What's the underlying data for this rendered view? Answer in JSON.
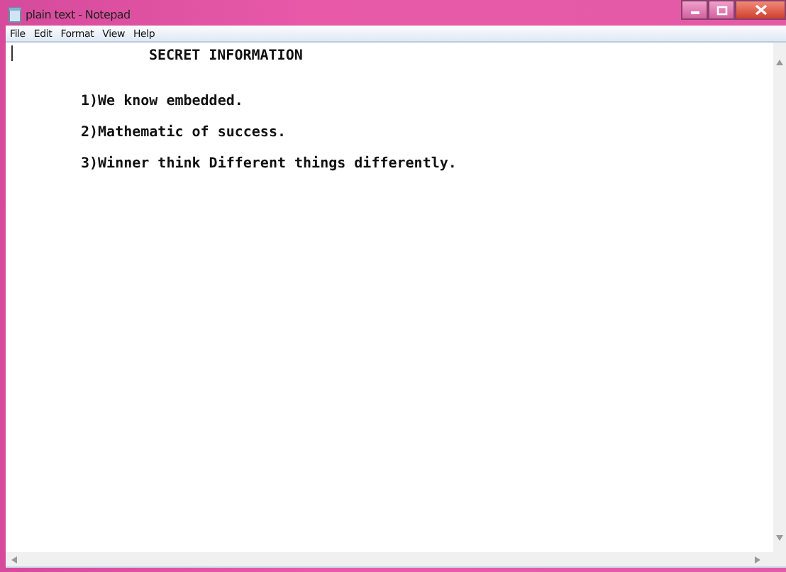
{
  "window": {
    "title": "plain text - Notepad"
  },
  "menu": [
    "File",
    "Edit",
    "Format",
    "View",
    "Help"
  ],
  "document": {
    "lines": [
      {
        "kind": "heading",
        "text": "SECRET INFORMATION"
      },
      {
        "kind": "item",
        "text": "1)We know embedded."
      },
      {
        "kind": "item",
        "text": "2)Mathematic of success."
      },
      {
        "kind": "item",
        "text": "3)Winner think Different things differently."
      }
    ]
  }
}
